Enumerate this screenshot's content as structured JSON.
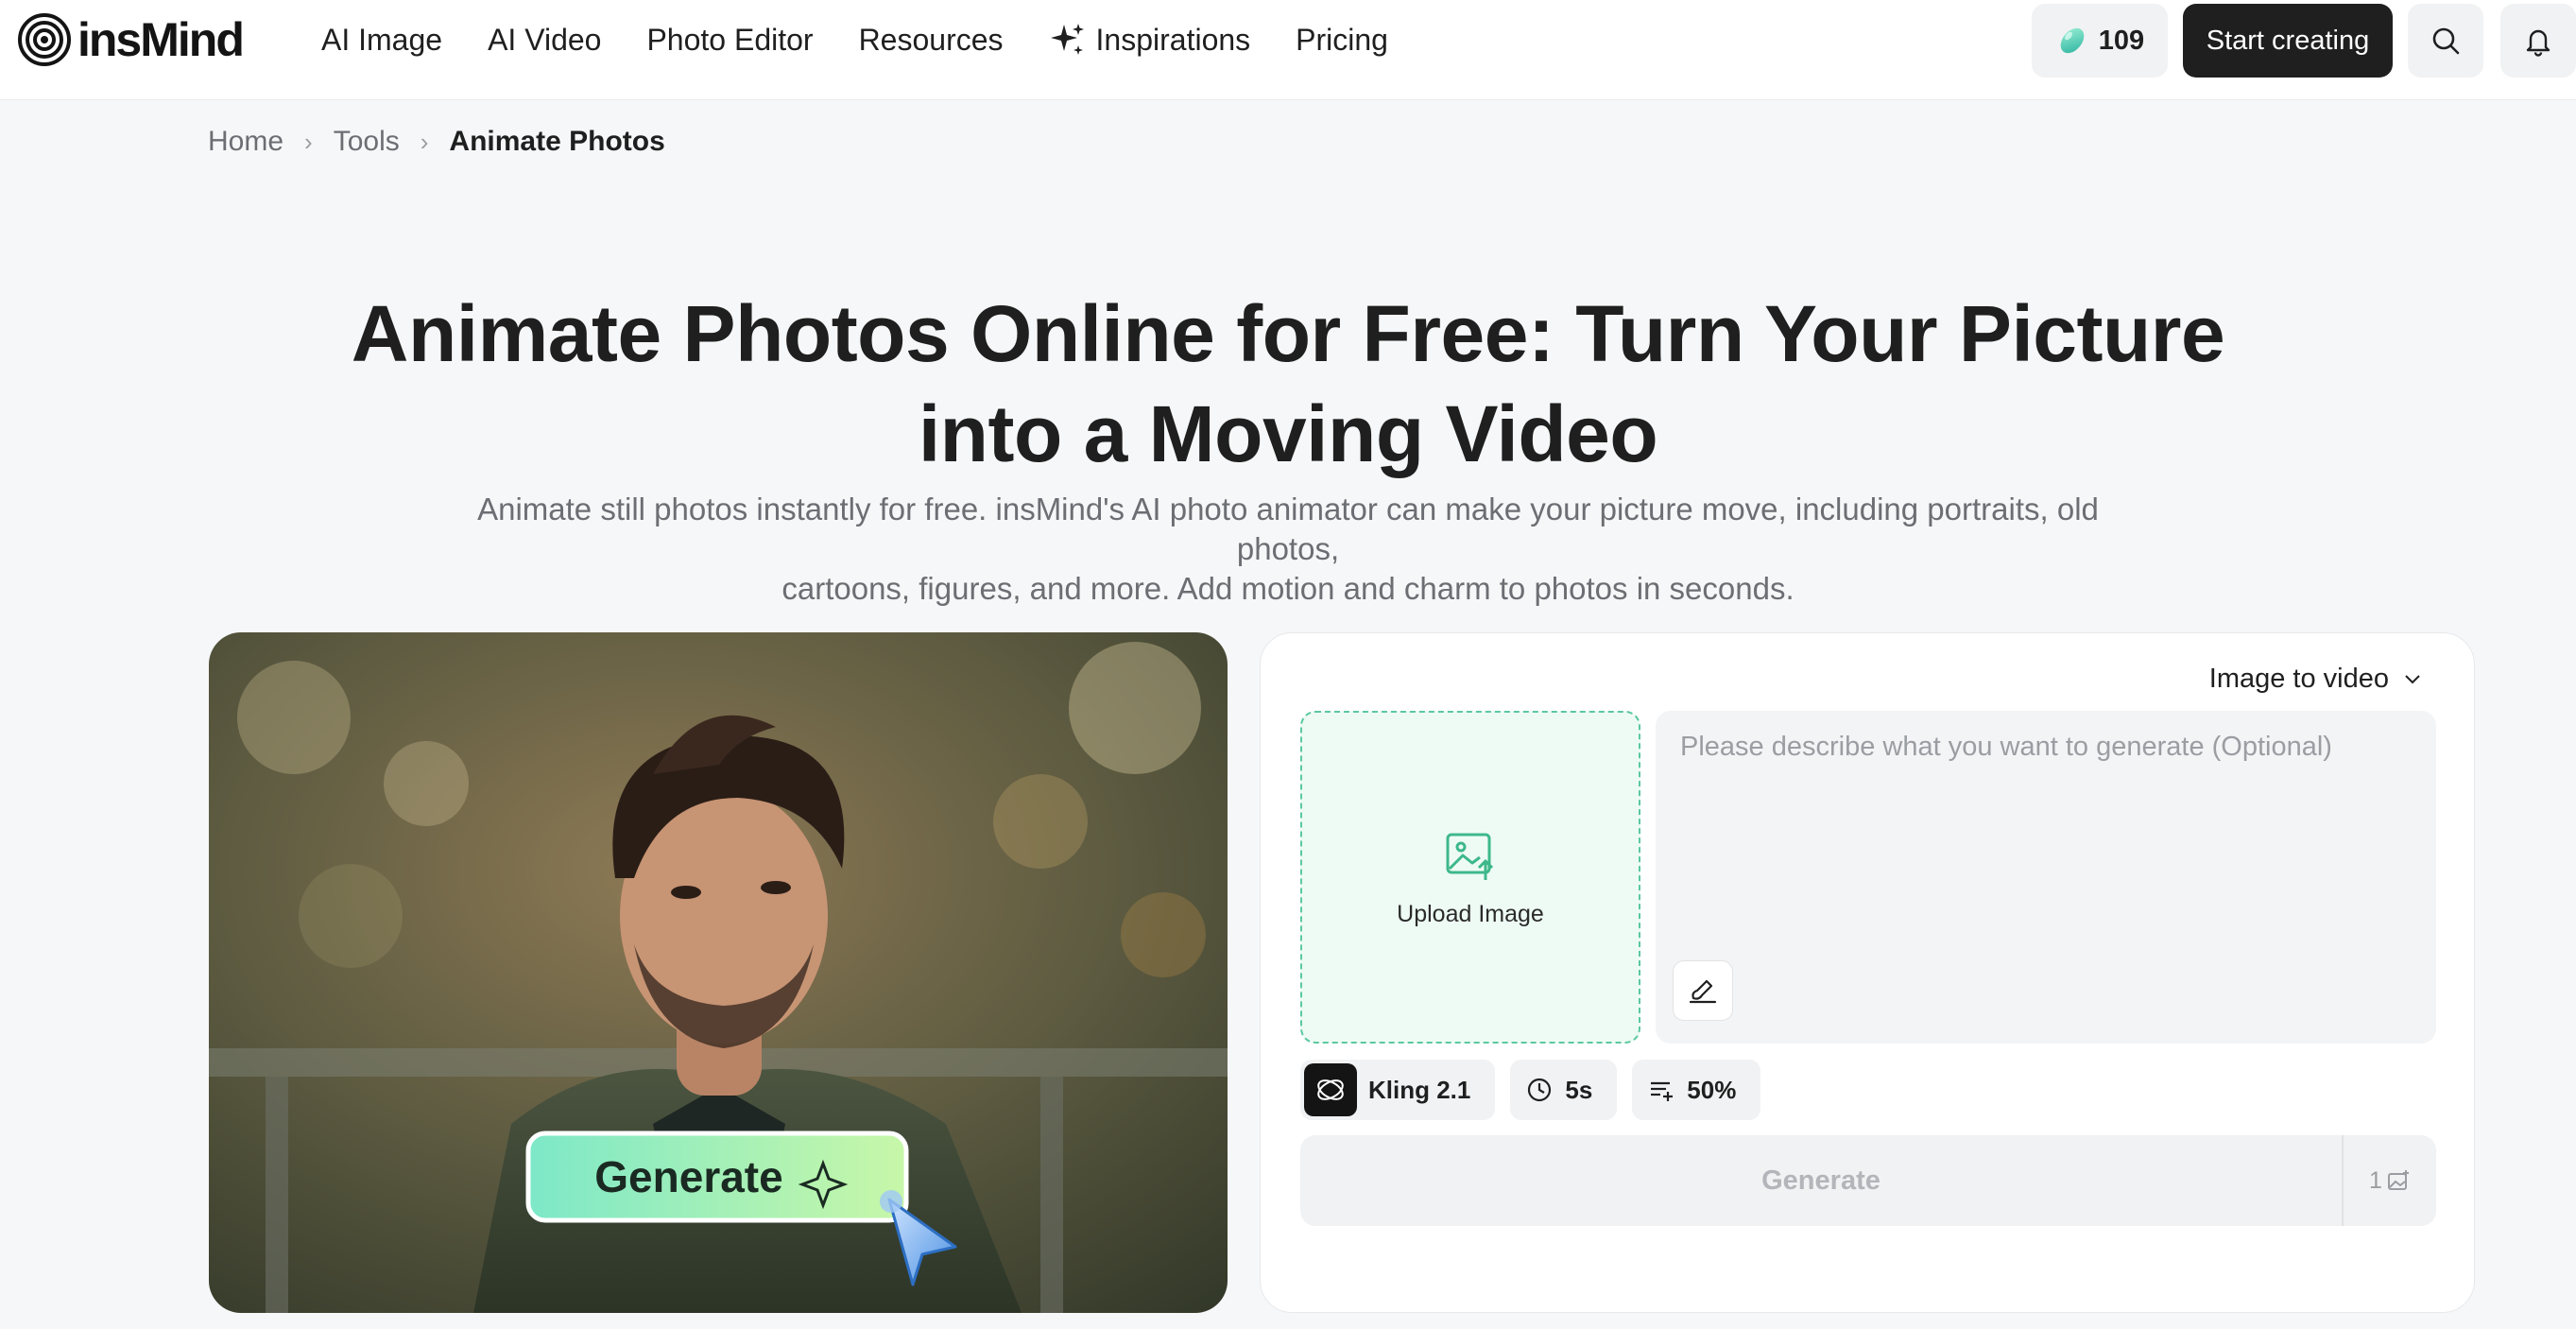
{
  "header": {
    "logo_text": "insMind",
    "nav": [
      {
        "label": "AI Image"
      },
      {
        "label": "AI Video"
      },
      {
        "label": "Photo Editor"
      },
      {
        "label": "Resources"
      },
      {
        "label": "Inspirations",
        "icon": "sparkle-icon"
      },
      {
        "label": "Pricing"
      }
    ],
    "credits": "109",
    "start_label": "Start creating"
  },
  "breadcrumb": {
    "home": "Home",
    "tools": "Tools",
    "current": "Animate Photos"
  },
  "hero": {
    "title_line1": "Animate Photos Online for Free: Turn Your Picture",
    "title_line2": "into a Moving Video",
    "subtitle_line1": "Animate still photos instantly for free. insMind's AI photo animator can make your picture move, including portraits, old photos,",
    "subtitle_line2": "cartoons, figures, and more. Add motion and charm to photos in seconds."
  },
  "preview": {
    "badge_label": "Generate"
  },
  "panel": {
    "mode": "Image to video",
    "upload_label": "Upload Image",
    "prompt_placeholder": "Please describe what you want to generate (Optional)",
    "prompt_value": "",
    "model": "Kling 2.1",
    "duration": "5s",
    "strength": "50%",
    "generate_label": "Generate",
    "generate_count": "1"
  },
  "colors": {
    "accent_green": "#5cc8a0",
    "dark": "#1f1f1f"
  }
}
